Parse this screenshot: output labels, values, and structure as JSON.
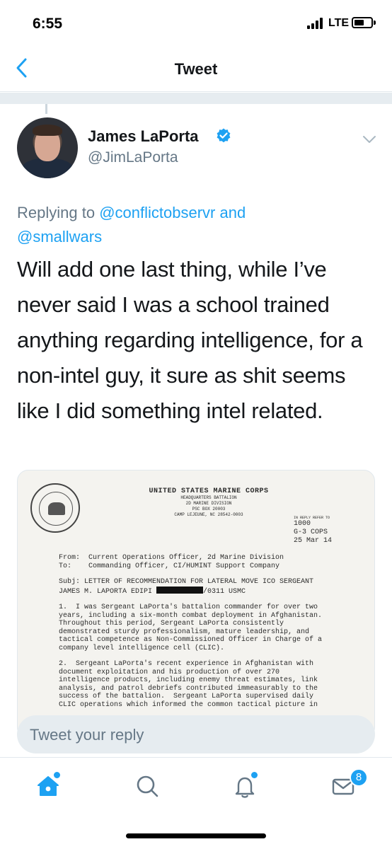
{
  "status_bar": {
    "time": "6:55",
    "network": "LTE"
  },
  "header": {
    "title": "Tweet"
  },
  "tweet": {
    "author_name": "James LaPorta",
    "author_handle": "@JimLaPorta",
    "replying_prefix": "Replying to",
    "replying_user_1": "@conflictobservr",
    "replying_and": "and",
    "replying_user_2": "@smallwars",
    "text": "Will add one last thing, while I’ve never said I was a school trained anything regarding intelligence, for a non-intel guy, it sure as shit seems like I did something intel related."
  },
  "document": {
    "org": "UNITED STATES MARINE CORPS",
    "unit_1": "HEADQUARTERS BATTALION",
    "unit_2": "2D MARINE DIVISION",
    "unit_3": "PSC BOX 20003",
    "unit_4": "CAMP LEJEUNE, NC 28542-0003",
    "refer_label": "IN REPLY REFER TO",
    "ref_1": "1000",
    "ref_2": "G-3 COPS",
    "ref_3": "25 Mar 14",
    "from_line": "From:  Current Operations Officer, 2d Marine Division",
    "to_line": "To:    Commanding Officer, CI/HUMINT Support Company",
    "subj_line": "Subj: LETTER OF RECOMMENDATION FOR LATERAL MOVE ICO SERGEANT",
    "name_prefix": "JAMES M. LAPORTA EDIPI ",
    "name_suffix": "/0311 USMC",
    "para_1": "1.  I was Sergeant LaPorta's battalion commander for over two\nyears, including a six-month combat deployment in Afghanistan.\nThroughout this period, Sergeant LaPorta consistently\ndemonstrated sturdy professionalism, mature leadership, and\ntactical competence as Non-Commissioned Officer in Charge of a\ncompany level intelligence cell (CLIC).",
    "para_2": "2.  Sergeant LaPorta's recent experience in Afghanistan with\ndocument exploitation and his production of over 270\nintelligence products, including enemy threat estimates, link\nanalysis, and patrol debriefs contributed immeasurably to the\nsuccess of the battalion.  Sergeant LaPorta supervised daily\nCLIC operations which informed the common tactical picture in"
  },
  "reply": {
    "placeholder": "Tweet your reply"
  },
  "tabbar": {
    "messages_badge": "8"
  },
  "colors": {
    "accent": "#1da1f2",
    "secondary_text": "#657786",
    "divider": "#e6ecf0"
  },
  "icons": [
    "back-chevron-icon",
    "verified-badge-icon",
    "caret-down-icon",
    "home-icon",
    "search-icon",
    "notifications-bell-icon",
    "messages-envelope-icon"
  ]
}
